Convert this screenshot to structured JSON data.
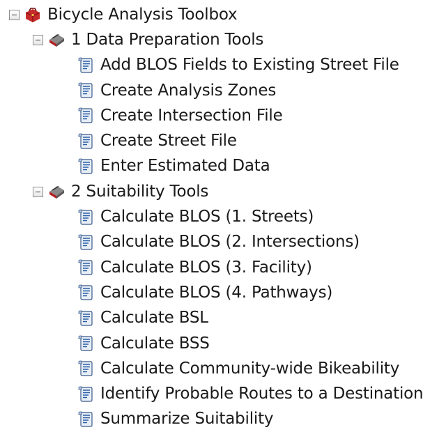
{
  "tree": {
    "root": {
      "label": "Bicycle Analysis Toolbox",
      "icon": "red-toolbox-icon",
      "expander": "collapse-minus-icon"
    },
    "sets": [
      {
        "label": "1 Data Preparation Tools",
        "icon": "toolset-icon",
        "expander": "collapse-minus-icon",
        "tools": [
          "Add BLOS Fields to Existing Street File",
          "Create Analysis Zones",
          "Create Intersection File",
          "Create Street File",
          "Enter Estimated Data"
        ]
      },
      {
        "label": "2 Suitability Tools",
        "icon": "toolset-icon",
        "expander": "collapse-minus-icon",
        "tools": [
          "Calculate BLOS (1. Streets)",
          "Calculate BLOS (2. Intersections)",
          "Calculate BLOS (3. Facility)",
          "Calculate BLOS (4. Pathways)",
          "Calculate BSL",
          "Calculate BSS",
          "Calculate Community-wide Bikeability",
          "Identify Probable Routes to a Destination",
          "Summarize Suitability"
        ]
      }
    ],
    "tool_icon": "script-tool-icon"
  }
}
